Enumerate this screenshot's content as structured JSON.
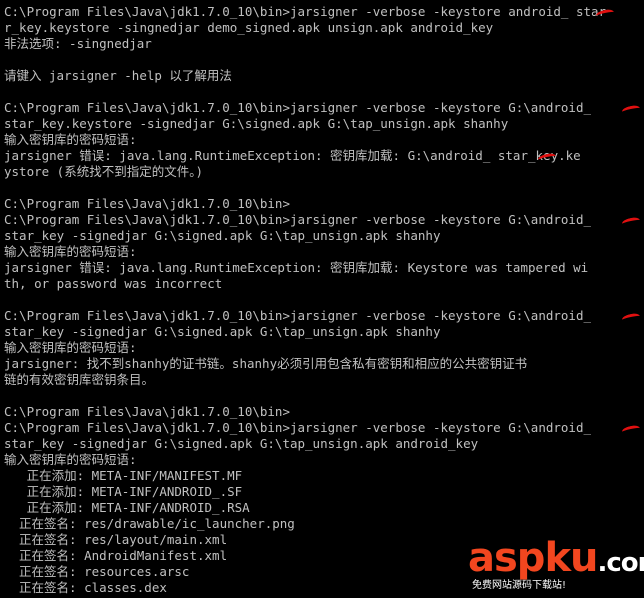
{
  "console": {
    "lines": [
      "C:\\Program Files\\Java\\jdk1.7.0_10\\bin>jarsigner -verbose -keystore android_ star",
      "r_key.keystore -singnedjar demo_signed.apk unsign.apk android_key",
      "非法选项: -singnedjar",
      "",
      "请键入 jarsigner -help 以了解用法",
      "",
      "C:\\Program Files\\Java\\jdk1.7.0_10\\bin>jarsigner -verbose -keystore G:\\android_",
      "star_key.keystore -signedjar G:\\signed.apk G:\\tap_unsign.apk shanhy",
      "输入密钥库的密码短语:",
      "jarsigner 错误: java.lang.RuntimeException: 密钥库加载: G:\\android_ star_key.ke",
      "ystore (系统找不到指定的文件。)",
      "",
      "C:\\Program Files\\Java\\jdk1.7.0_10\\bin>",
      "C:\\Program Files\\Java\\jdk1.7.0_10\\bin>jarsigner -verbose -keystore G:\\android_",
      "star_key -signedjar G:\\signed.apk G:\\tap_unsign.apk shanhy",
      "输入密钥库的密码短语:",
      "jarsigner 错误: java.lang.RuntimeException: 密钥库加载: Keystore was tampered wi",
      "th, or password was incorrect",
      "",
      "C:\\Program Files\\Java\\jdk1.7.0_10\\bin>jarsigner -verbose -keystore G:\\android_",
      "star_key -signedjar G:\\signed.apk G:\\tap_unsign.apk shanhy",
      "输入密钥库的密码短语:",
      "jarsigner: 找不到shanhy的证书链。shanhy必须引用包含私有密钥和相应的公共密钥证书",
      "链的有效密钥库密钥条目。",
      "",
      "C:\\Program Files\\Java\\jdk1.7.0_10\\bin>",
      "C:\\Program Files\\Java\\jdk1.7.0_10\\bin>jarsigner -verbose -keystore G:\\android_",
      "star_key -signedjar G:\\signed.apk G:\\tap_unsign.apk android_key",
      "输入密钥库的密码短语:",
      "   正在添加: META-INF/MANIFEST.MF",
      "   正在添加: META-INF/ANDROID_.SF",
      "   正在添加: META-INF/ANDROID_.RSA",
      "  正在签名: res/drawable/ic_launcher.png",
      "  正在签名: res/layout/main.xml",
      "  正在签名: AndroidManifest.xml",
      "  正在签名: resources.arsc",
      "  正在签名: classes.dex"
    ]
  },
  "watermark": {
    "brand_a": "asp",
    "brand_b": "ku",
    "brand_dot": ".com",
    "tagline": "免费网站源码下载站!"
  },
  "colors": {
    "background": "#000000",
    "text": "#c0c0c0",
    "redaction": "#e01010",
    "watermark": "#f2461f"
  }
}
